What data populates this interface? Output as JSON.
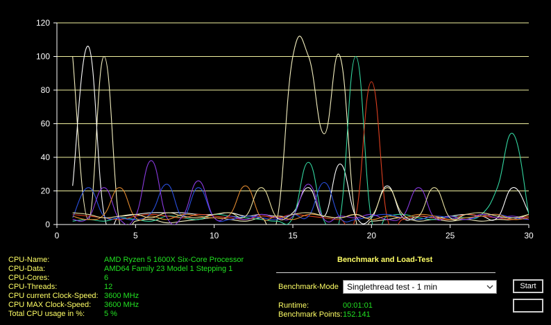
{
  "chart_data": {
    "type": "line",
    "xlim": [
      0,
      30
    ],
    "ylim": [
      0,
      120
    ],
    "x_ticks": [
      0,
      5,
      10,
      15,
      20,
      25,
      30
    ],
    "y_ticks": [
      0,
      20,
      40,
      60,
      80,
      100,
      120
    ],
    "grid": "horizontal",
    "series": [
      {
        "color": "#f5f0c0",
        "x": [
          1,
          2,
          3,
          4,
          5,
          6,
          7,
          8,
          9,
          10,
          11,
          12,
          13,
          14,
          15,
          16,
          17,
          18,
          19,
          20,
          21,
          22,
          23,
          24,
          25,
          26,
          27,
          28,
          29,
          30
        ],
        "values": [
          100,
          3,
          100,
          0,
          2,
          3,
          1,
          2,
          3,
          4,
          3,
          2,
          4,
          3,
          100,
          100,
          54,
          100,
          3,
          2,
          3,
          4,
          2,
          3,
          2,
          3,
          2,
          3,
          3,
          6
        ]
      },
      {
        "color": "#ffffff",
        "x": [
          1,
          2,
          3,
          4,
          5,
          6,
          7,
          8,
          9,
          10,
          11,
          12,
          13,
          14,
          15,
          16,
          17,
          18,
          19,
          20,
          21,
          22,
          23,
          24,
          25,
          26,
          27,
          28,
          29,
          30
        ],
        "values": [
          23,
          106,
          6,
          5,
          6,
          7,
          7,
          7,
          6,
          6,
          7,
          5,
          6,
          5,
          7,
          22,
          5,
          36,
          5,
          4,
          23,
          4,
          5,
          4,
          5,
          6,
          5,
          4,
          22,
          7
        ]
      },
      {
        "color": "#33d6a0",
        "x": [
          1,
          2,
          3,
          4,
          5,
          6,
          7,
          8,
          9,
          10,
          11,
          12,
          13,
          14,
          15,
          16,
          17,
          18,
          19,
          20,
          21,
          22,
          23,
          24,
          25,
          26,
          27,
          28,
          29,
          30
        ],
        "values": [
          2,
          3,
          2,
          4,
          3,
          2,
          5,
          4,
          3,
          6,
          5,
          4,
          3,
          2,
          4,
          37,
          2,
          4,
          100,
          3,
          5,
          6,
          4,
          3,
          5,
          4,
          6,
          22,
          54,
          6
        ]
      },
      {
        "color": "#e04020",
        "x": [
          1,
          2,
          3,
          4,
          5,
          6,
          7,
          8,
          9,
          10,
          11,
          12,
          13,
          14,
          15,
          16,
          17,
          18,
          19,
          20,
          21,
          22,
          23,
          24,
          25,
          26,
          27,
          28,
          29,
          30
        ],
        "values": [
          6,
          5,
          4,
          3,
          5,
          6,
          5,
          4,
          6,
          5,
          4,
          3,
          5,
          4,
          6,
          5,
          4,
          3,
          5,
          85,
          4,
          3,
          5,
          4,
          3,
          6,
          5,
          4,
          3,
          5
        ]
      },
      {
        "color": "#2a50e0",
        "x": [
          1,
          2,
          3,
          4,
          5,
          6,
          7,
          8,
          9,
          10,
          11,
          12,
          13,
          14,
          15,
          16,
          17,
          18,
          19,
          20,
          21,
          22,
          23,
          24,
          25,
          26,
          27,
          28,
          29,
          30
        ],
        "values": [
          4,
          22,
          5,
          4,
          3,
          7,
          24,
          5,
          22,
          4,
          3,
          5,
          4,
          3,
          6,
          5,
          25,
          4,
          3,
          5,
          6,
          4,
          3,
          5,
          4,
          3,
          5,
          6,
          4,
          3
        ]
      },
      {
        "color": "#8a3ae0",
        "x": [
          1,
          2,
          3,
          4,
          5,
          6,
          7,
          8,
          9,
          10,
          11,
          12,
          13,
          14,
          15,
          16,
          17,
          18,
          19,
          20,
          21,
          22,
          23,
          24,
          25,
          26,
          27,
          28,
          29,
          30
        ],
        "values": [
          3,
          4,
          22,
          3,
          5,
          38,
          4,
          5,
          26,
          4,
          5,
          3,
          6,
          4,
          5,
          24,
          3,
          5,
          4,
          6,
          3,
          5,
          22,
          4,
          5,
          3,
          6,
          4,
          5,
          3
        ]
      },
      {
        "color": "#e08a30",
        "x": [
          1,
          2,
          3,
          4,
          5,
          6,
          7,
          8,
          9,
          10,
          11,
          12,
          13,
          14,
          15,
          16,
          17,
          18,
          19,
          20,
          21,
          22,
          23,
          24,
          25,
          26,
          27,
          28,
          29,
          30
        ],
        "values": [
          5,
          3,
          6,
          22,
          4,
          5,
          3,
          6,
          5,
          4,
          6,
          23,
          4,
          5,
          3,
          6,
          5,
          4,
          6,
          3,
          5,
          4,
          6,
          5,
          3,
          4,
          5,
          6,
          3,
          4
        ]
      },
      {
        "color": "#e8e0a0",
        "x": [
          1,
          2,
          3,
          4,
          5,
          6,
          7,
          8,
          9,
          10,
          11,
          12,
          13,
          14,
          15,
          16,
          17,
          18,
          19,
          20,
          21,
          22,
          23,
          24,
          25,
          26,
          27,
          28,
          29,
          30
        ],
        "values": [
          7,
          6,
          4,
          5,
          6,
          4,
          7,
          5,
          4,
          6,
          7,
          5,
          22,
          4,
          6,
          7,
          5,
          4,
          6,
          5,
          22,
          6,
          5,
          22,
          4,
          6,
          7,
          5,
          4,
          6
        ]
      }
    ]
  },
  "info": {
    "cpu_name_label": "CPU-Name:",
    "cpu_name": "AMD Ryzen 5 1600X Six-Core Processor",
    "cpu_data_label": "CPU-Data:",
    "cpu_data": "AMD64 Family 23 Model 1 Stepping 1",
    "cpu_cores_label": "CPU-Cores:",
    "cpu_cores": "6",
    "cpu_threads_label": "CPU-Threads:",
    "cpu_threads": "12",
    "cpu_clock_label": "CPU current Clock-Speed:",
    "cpu_clock": "3600 MHz",
    "cpu_max_clock_label": "CPU MAX Clock-Speed:",
    "cpu_max_clock": "3600 MHz",
    "cpu_usage_label": "Total CPU usage in %:",
    "cpu_usage": "5 %"
  },
  "benchmark": {
    "title": "Benchmark and Load-Test",
    "mode_label": "Benchmark-Mode",
    "mode_value": "Singlethread test - 1 min",
    "runtime_label": "Runtime:",
    "runtime": "00:01:01",
    "points_label": "Benchmark Points:",
    "points": "152.141",
    "start_label": "Start",
    "second_button_label": ""
  },
  "colors": {
    "label": "#ffff66",
    "value": "#22e022",
    "grid": "#f2f2a0"
  }
}
